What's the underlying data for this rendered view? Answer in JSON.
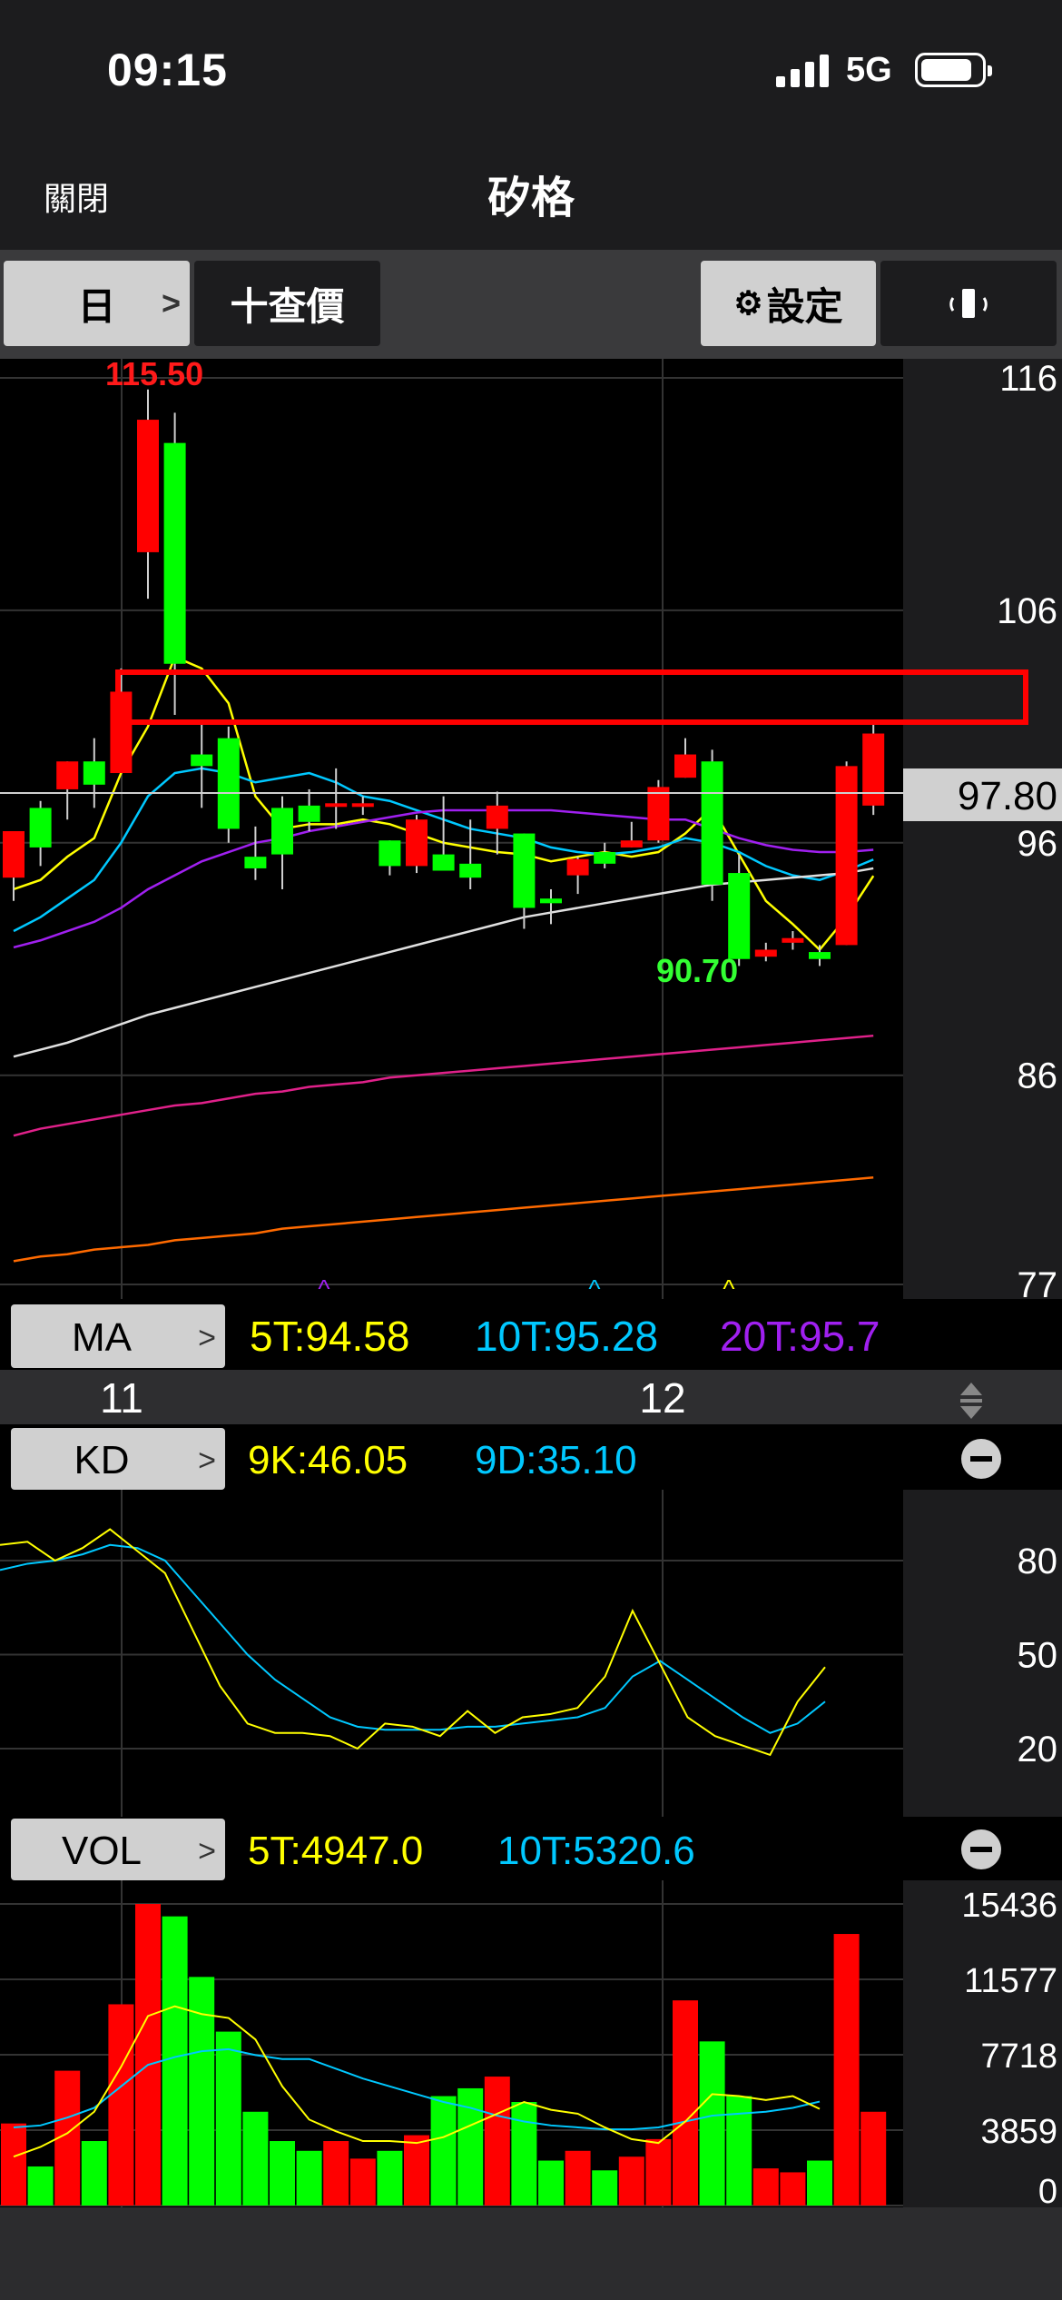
{
  "status_bar": {
    "time": "09:15",
    "network": "5G",
    "icons": [
      "signal-bars-icon",
      "battery-icon"
    ]
  },
  "header": {
    "close_label": "關閉",
    "title": "矽格"
  },
  "toolbar": {
    "period_label": "日",
    "query_label": "十查價",
    "settings_label": "設定",
    "icons": [
      "chevron-right-icon",
      "gear-icon",
      "rotate-screen-icon"
    ]
  },
  "colors": {
    "up": "#ff0000",
    "down": "#00ff00",
    "ma5": "#ffff00",
    "ma10": "#00c8ff",
    "ma20": "#a020f0",
    "ma60": "#e0e0e0",
    "ma120": "#e0218a",
    "ma240": "#ff6a00",
    "highlight_box": "#ff0000"
  },
  "price_axis": {
    "ticks": [
      "116",
      "106",
      "96",
      "86",
      "77"
    ],
    "current_price": "97.80"
  },
  "annotations": {
    "high_label": "115.50",
    "low_label": "90.70"
  },
  "ma_panel": {
    "label": "MA",
    "items": [
      {
        "text": "5T:94.58"
      },
      {
        "text": "10T:95.28"
      },
      {
        "text": "20T:95.7"
      }
    ]
  },
  "date_axis": {
    "labels": [
      "11",
      "12"
    ]
  },
  "kd_panel": {
    "label": "KD",
    "items": [
      {
        "text": "9K:46.05"
      },
      {
        "text": "9D:35.10"
      }
    ],
    "ticks": [
      "80",
      "50",
      "20"
    ]
  },
  "vol_panel": {
    "label": "VOL",
    "items": [
      {
        "text": "5T:4947.0"
      },
      {
        "text": "10T:5320.6"
      }
    ],
    "ticks": [
      "15436",
      "11577",
      "7718",
      "3859",
      "0"
    ]
  },
  "chart_data": {
    "type": "candlestick",
    "ylim": [
      77,
      116
    ],
    "candles": [
      {
        "o": 94.5,
        "h": 96.5,
        "l": 93.5,
        "c": 96.5
      },
      {
        "o": 97.5,
        "h": 97.8,
        "l": 95.0,
        "c": 95.8
      },
      {
        "o": 98.3,
        "h": 99.5,
        "l": 97.0,
        "c": 99.5
      },
      {
        "o": 99.5,
        "h": 100.5,
        "l": 97.5,
        "c": 98.5
      },
      {
        "o": 99.0,
        "h": 103.5,
        "l": 99.0,
        "c": 102.5
      },
      {
        "o": 108.5,
        "h": 115.5,
        "l": 106.5,
        "c": 114.2
      },
      {
        "o": 113.2,
        "h": 114.5,
        "l": 101.5,
        "c": 103.7
      },
      {
        "o": 99.8,
        "h": 101.2,
        "l": 97.5,
        "c": 99.3
      },
      {
        "o": 100.5,
        "h": 101.0,
        "l": 96.0,
        "c": 96.6
      },
      {
        "o": 95.4,
        "h": 96.7,
        "l": 94.4,
        "c": 94.9
      },
      {
        "o": 97.5,
        "h": 98.0,
        "l": 94.0,
        "c": 95.5
      },
      {
        "o": 97.6,
        "h": 98.3,
        "l": 96.5,
        "c": 96.9
      },
      {
        "o": 97.6,
        "h": 99.2,
        "l": 96.6,
        "c": 97.7
      },
      {
        "o": 97.6,
        "h": 98.0,
        "l": 97.2,
        "c": 97.7
      },
      {
        "o": 96.1,
        "h": 96.1,
        "l": 94.6,
        "c": 95.0
      },
      {
        "o": 95.0,
        "h": 97.2,
        "l": 94.7,
        "c": 97.0
      },
      {
        "o": 95.5,
        "h": 98.0,
        "l": 94.8,
        "c": 94.8
      },
      {
        "o": 95.1,
        "h": 97.0,
        "l": 94.0,
        "c": 94.5
      },
      {
        "o": 96.6,
        "h": 98.2,
        "l": 95.5,
        "c": 97.6
      },
      {
        "o": 96.4,
        "h": 96.4,
        "l": 92.3,
        "c": 93.2
      },
      {
        "o": 93.6,
        "h": 94.0,
        "l": 92.5,
        "c": 93.4
      },
      {
        "o": 94.6,
        "h": 95.4,
        "l": 93.8,
        "c": 95.3
      },
      {
        "o": 95.6,
        "h": 96.0,
        "l": 94.9,
        "c": 95.1
      },
      {
        "o": 95.8,
        "h": 96.9,
        "l": 95.8,
        "c": 96.1
      },
      {
        "o": 96.1,
        "h": 98.7,
        "l": 96.0,
        "c": 98.4
      },
      {
        "o": 98.8,
        "h": 100.5,
        "l": 98.8,
        "c": 99.8
      },
      {
        "o": 99.5,
        "h": 100.0,
        "l": 93.5,
        "c": 94.2
      },
      {
        "o": 94.7,
        "h": 95.5,
        "l": 90.7,
        "c": 91.0
      },
      {
        "o": 91.1,
        "h": 91.7,
        "l": 90.9,
        "c": 91.4
      },
      {
        "o": 91.7,
        "h": 92.2,
        "l": 91.4,
        "c": 91.9
      },
      {
        "o": 91.3,
        "h": 91.6,
        "l": 90.7,
        "c": 91.0
      },
      {
        "o": 91.6,
        "h": 99.5,
        "l": 91.6,
        "c": 99.3
      },
      {
        "o": 97.6,
        "h": 101.2,
        "l": 97.2,
        "c": 100.7
      }
    ],
    "ma_lines": [
      {
        "name": "5T",
        "values": [
          94.0,
          94.4,
          95.4,
          96.2,
          99.0,
          101.0,
          104.0,
          103.5,
          102.0,
          98.0,
          96.6,
          96.8,
          96.8,
          97.0,
          96.8,
          96.4,
          96.0,
          95.8,
          95.6,
          95.5,
          95.2,
          95.4,
          95.6,
          95.4,
          95.6,
          96.4,
          97.5,
          95.5,
          93.5,
          92.5,
          91.4,
          92.8,
          94.58
        ]
      },
      {
        "name": "10T",
        "values": [
          92.2,
          92.8,
          93.6,
          94.4,
          96.0,
          98.0,
          99.0,
          99.2,
          99.0,
          98.6,
          98.8,
          99.0,
          98.6,
          98.0,
          97.8,
          97.4,
          97.0,
          96.6,
          96.4,
          96.2,
          95.8,
          95.6,
          95.5,
          95.6,
          95.8,
          96.2,
          96.0,
          95.6,
          95.0,
          94.6,
          94.4,
          94.8,
          95.28
        ]
      },
      {
        "name": "20T",
        "values": [
          91.5,
          91.8,
          92.2,
          92.6,
          93.2,
          94.0,
          94.6,
          95.2,
          95.6,
          96.0,
          96.2,
          96.5,
          96.7,
          96.9,
          97.1,
          97.3,
          97.4,
          97.4,
          97.4,
          97.4,
          97.4,
          97.3,
          97.2,
          97.1,
          97.0,
          97.0,
          96.6,
          96.2,
          95.9,
          95.7,
          95.6,
          95.6,
          95.7
        ]
      },
      {
        "name": "60T",
        "values": [
          86.8,
          87.1,
          87.4,
          87.8,
          88.2,
          88.6,
          88.9,
          89.2,
          89.5,
          89.8,
          90.1,
          90.4,
          90.7,
          91.0,
          91.3,
          91.6,
          91.9,
          92.2,
          92.5,
          92.8,
          93.0,
          93.2,
          93.4,
          93.6,
          93.8,
          94.0,
          94.2,
          94.3,
          94.4,
          94.5,
          94.6,
          94.7,
          94.9
        ]
      },
      {
        "name": "120T",
        "values": [
          83.4,
          83.7,
          83.9,
          84.1,
          84.3,
          84.5,
          84.7,
          84.8,
          85.0,
          85.2,
          85.3,
          85.5,
          85.6,
          85.7,
          85.9,
          86.0,
          86.1,
          86.2,
          86.3,
          86.4,
          86.5,
          86.6,
          86.7,
          86.8,
          86.9,
          87.0,
          87.1,
          87.2,
          87.3,
          87.4,
          87.5,
          87.6,
          87.7
        ]
      },
      {
        "name": "240T",
        "values": [
          78.0,
          78.2,
          78.3,
          78.5,
          78.6,
          78.7,
          78.9,
          79.0,
          79.1,
          79.2,
          79.4,
          79.5,
          79.6,
          79.7,
          79.8,
          79.9,
          80.0,
          80.1,
          80.2,
          80.3,
          80.4,
          80.5,
          80.6,
          80.7,
          80.8,
          80.9,
          81.0,
          81.1,
          81.2,
          81.3,
          81.4,
          81.5,
          81.6
        ]
      }
    ],
    "kd": {
      "k": [
        85,
        86,
        80,
        84,
        90,
        83,
        76,
        58,
        40,
        28,
        25,
        25,
        24,
        20,
        28,
        27,
        24,
        32,
        25,
        30,
        31,
        33,
        43,
        64,
        47,
        30,
        24,
        21,
        18,
        35,
        46
      ],
      "d": [
        77,
        79,
        80,
        82,
        85,
        84,
        80,
        70,
        60,
        50,
        42,
        36,
        30,
        27,
        26,
        26,
        26,
        27,
        27,
        28,
        29,
        30,
        33,
        43,
        48,
        42,
        36,
        30,
        25,
        28,
        35
      ]
    },
    "volume": {
      "values": [
        4200,
        2000,
        6900,
        3300,
        10300,
        15436,
        14800,
        11700,
        8900,
        4800,
        3300,
        2800,
        3300,
        2400,
        2800,
        3600,
        5600,
        6000,
        6600,
        5300,
        2300,
        2800,
        1800,
        2500,
        3400,
        10500,
        8400,
        5600,
        1900,
        1700,
        2300,
        13900,
        4800
      ],
      "ma5": [
        2500,
        3000,
        3700,
        4800,
        7100,
        9700,
        10200,
        9800,
        9600,
        8500,
        6100,
        4400,
        3800,
        3300,
        3300,
        3200,
        3500,
        4100,
        4700,
        5300,
        4900,
        4700,
        4000,
        3400,
        3200,
        4300,
        5700,
        5600,
        5400,
        5600,
        4947.0
      ],
      "ma10": [
        4000,
        4100,
        4500,
        5000,
        6100,
        7200,
        7600,
        7900,
        8000,
        7700,
        7500,
        7500,
        7000,
        6500,
        6100,
        5700,
        5300,
        5000,
        4600,
        4300,
        4100,
        4000,
        3900,
        3900,
        4000,
        4300,
        4600,
        4700,
        4800,
        5000,
        5320.6
      ]
    }
  }
}
